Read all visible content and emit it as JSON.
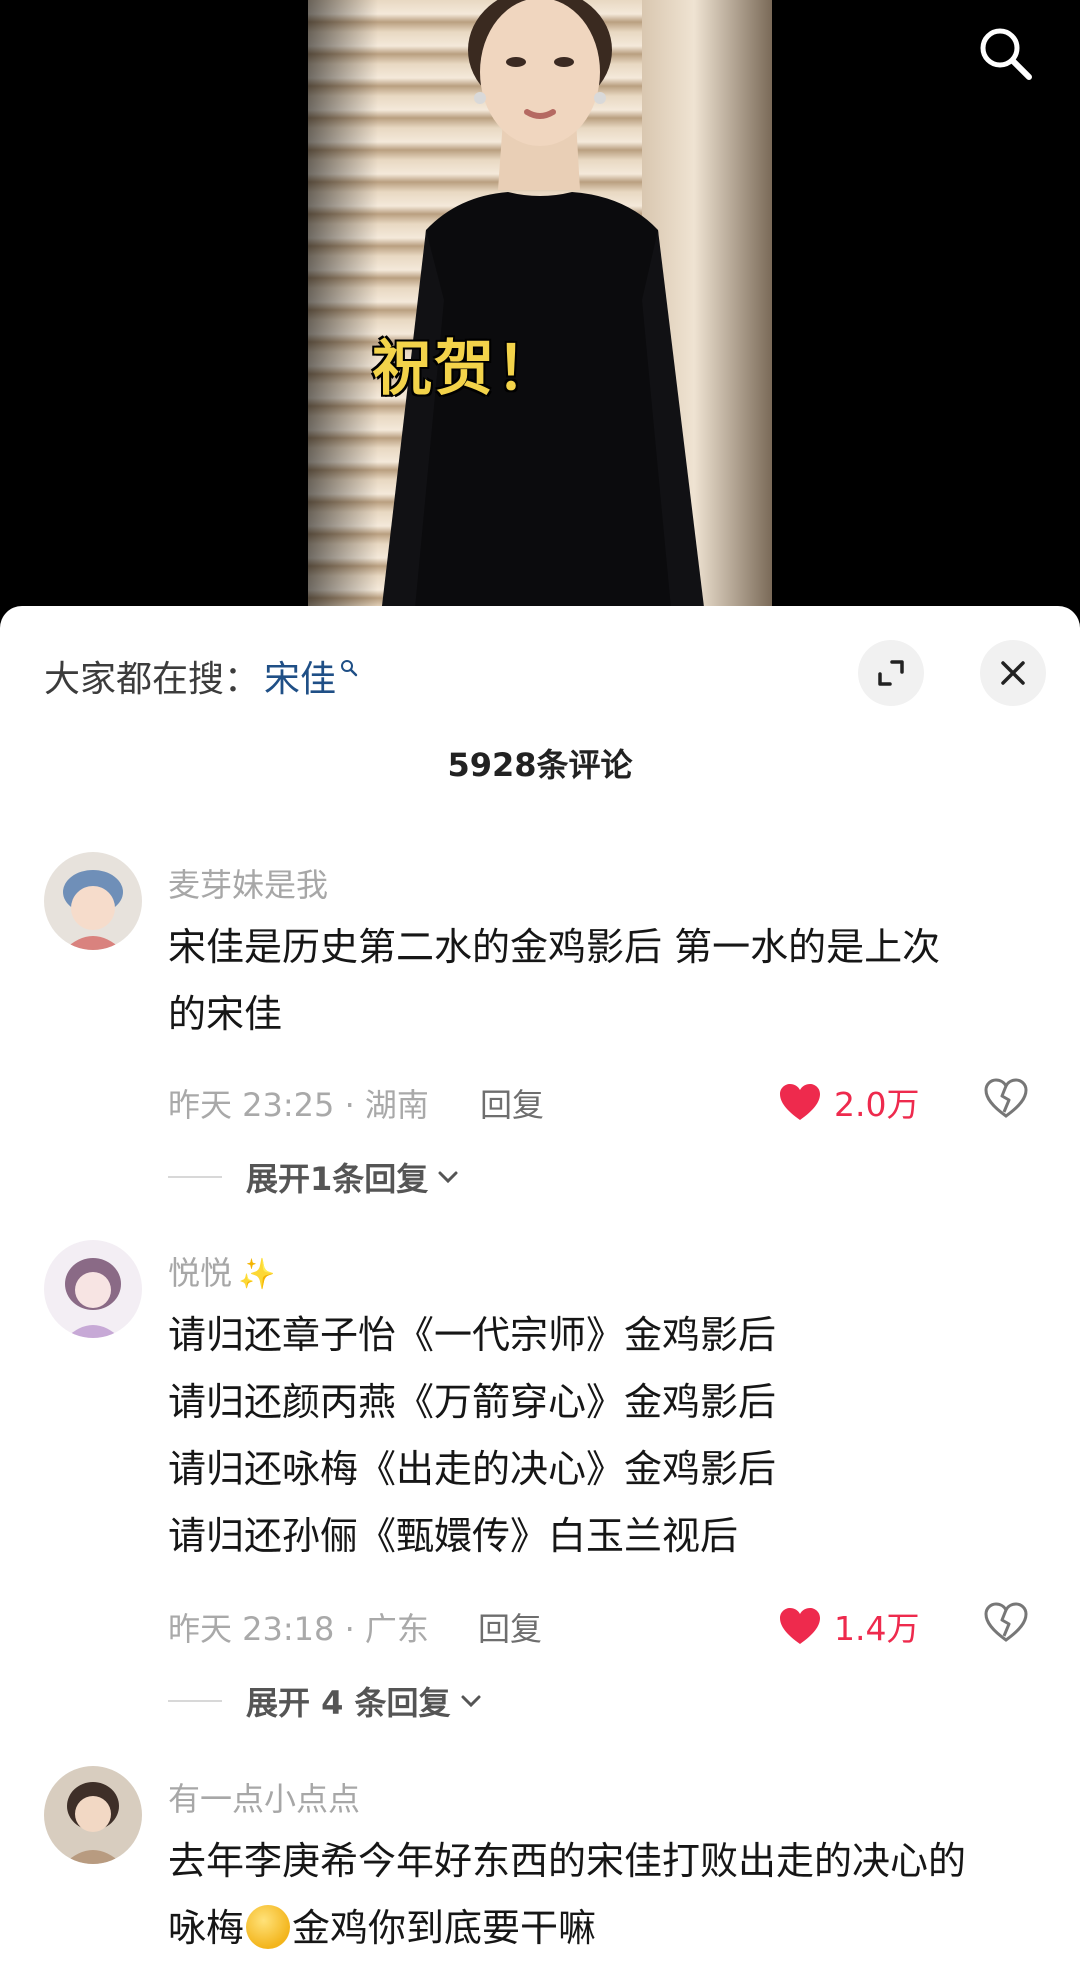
{
  "video": {
    "overlay_text": "祝贺！"
  },
  "sheet": {
    "hot_search_label": "大家都在搜：",
    "hot_search_term": "宋佳",
    "comment_count": "5928条评论"
  },
  "comments": [
    {
      "username": "麦芽妹是我",
      "lines": [
        "宋佳是历史第二水的金鸡影后  第一水的是上次",
        "的宋佳"
      ],
      "time_location": "昨天 23:25 · 湖南",
      "reply": "回复",
      "likes": "2.0万",
      "expand": "展开1条回复"
    },
    {
      "username": "悦悦",
      "lines": [
        "请归还章子怡《一代宗师》金鸡影后",
        "请归还颜丙燕《万箭穿心》金鸡影后",
        "请归还咏梅《出走的决心》金鸡影后",
        "请归还孙俪《甄嬛传》白玉兰视后"
      ],
      "time_location": "昨天 23:18 · 广东",
      "reply": "回复",
      "likes": "1.4万",
      "expand": "展开 4 条回复"
    },
    {
      "username": "有一点小点点",
      "line1": "去年李庚希今年好东西的宋佳打败出走的决心的",
      "line2_before": "咏梅",
      "line2_after": "金鸡你到底要干嘛"
    }
  ],
  "colors": {
    "like_red": "#ee2a4d",
    "search_link": "#1f4f86",
    "overlay_yellow": "#f3d34a"
  },
  "icons": [
    "search-icon",
    "expand-icon",
    "close-icon",
    "heart-icon",
    "broken-heart-icon",
    "chevron-down-icon",
    "sparkle-icon",
    "facepalm-emoji"
  ]
}
